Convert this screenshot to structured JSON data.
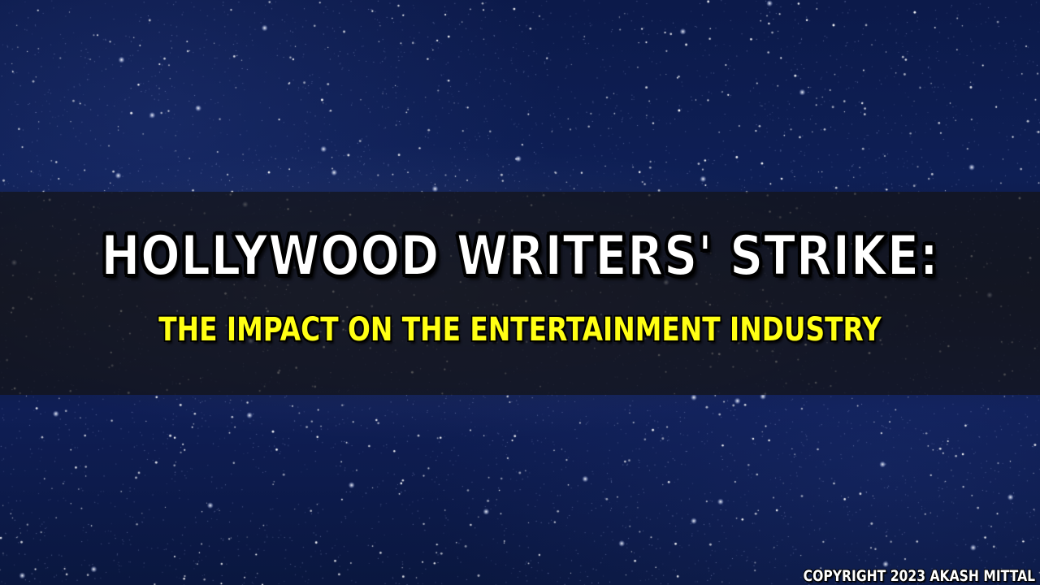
{
  "title": "HOLLYWOOD WRITERS' STRIKE:",
  "subtitle": "THE IMPACT ON THE ENTERTAINMENT INDUSTRY",
  "copyright": "COPYRIGHT 2023 AKASH MITTAL",
  "colors": {
    "title": "#ffffff",
    "subtitle": "#ffff14",
    "band": "#141416",
    "sky": "#0e1f55"
  }
}
